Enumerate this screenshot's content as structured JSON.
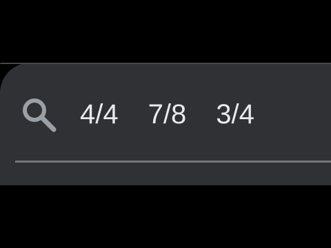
{
  "search": {
    "query_tokens": [
      "4/4",
      "7/8",
      "3/4"
    ]
  },
  "icons": {
    "search": "search-icon"
  },
  "colors": {
    "background": "#000000",
    "panel": "#303134",
    "text": "#e8eaed",
    "icon": "#9aa0a6",
    "underline": "#75777b"
  }
}
